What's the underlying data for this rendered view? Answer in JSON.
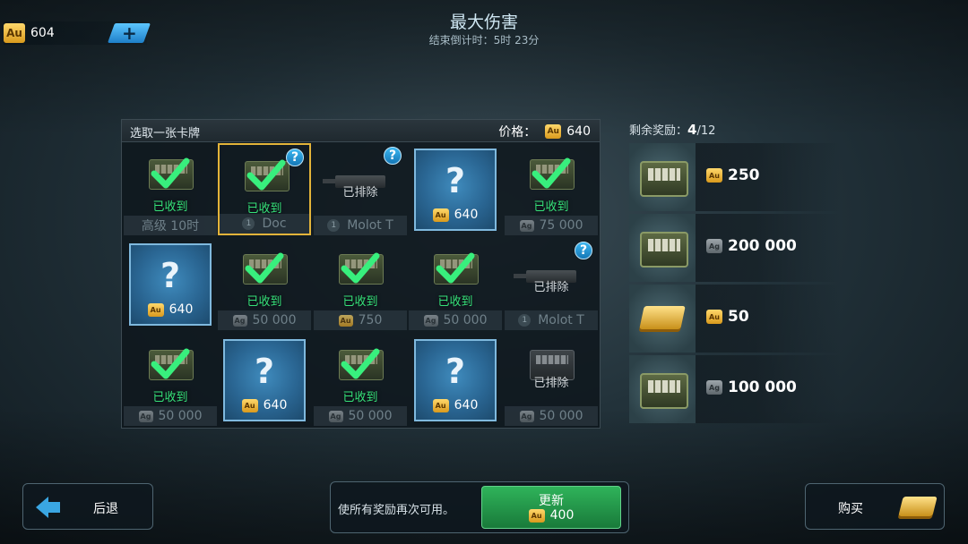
{
  "currency": {
    "badge": "Au",
    "amount": "604",
    "add_label": "+"
  },
  "header": {
    "title": "最大伤害",
    "subtitle": "结束倒计时：5时 23分"
  },
  "board": {
    "label": "选取一张卡牌",
    "price_label": "价格：",
    "price_badge": "Au",
    "price": "640",
    "cells": [
      {
        "state": "got",
        "got_label": "已收到",
        "footer": "高级 10时",
        "footer_icon": "none"
      },
      {
        "state": "got",
        "got_label": "已收到",
        "footer": "Doc",
        "footer_icon": "num",
        "footer_num": "1",
        "selected": true,
        "help": "?"
      },
      {
        "state": "excluded",
        "excluded_label": "已排除",
        "footer": "Molot T",
        "footer_icon": "num",
        "footer_num": "1",
        "help": "?"
      },
      {
        "state": "card",
        "q": "?",
        "badge": "Au",
        "cost": "640"
      },
      {
        "state": "got",
        "got_label": "已收到",
        "footer": "75 000",
        "footer_icon": "ag",
        "footer_badge": "Ag"
      },
      {
        "state": "card",
        "q": "?",
        "badge": "Au",
        "cost": "640"
      },
      {
        "state": "got",
        "got_label": "已收到",
        "footer": "50 000",
        "footer_icon": "ag",
        "footer_badge": "Ag"
      },
      {
        "state": "got",
        "got_label": "已收到",
        "footer": "750",
        "footer_icon": "au",
        "footer_badge": "Au"
      },
      {
        "state": "got",
        "got_label": "已收到",
        "footer": "50 000",
        "footer_icon": "ag",
        "footer_badge": "Ag"
      },
      {
        "state": "excluded",
        "excluded_label": "已排除",
        "footer": "Molot T",
        "footer_icon": "num",
        "footer_num": "1",
        "help": "?"
      },
      {
        "state": "got",
        "got_label": "已收到",
        "footer": "50 000",
        "footer_icon": "ag",
        "footer_badge": "Ag"
      },
      {
        "state": "card",
        "q": "?",
        "badge": "Au",
        "cost": "640"
      },
      {
        "state": "got",
        "got_label": "已收到",
        "footer": "50 000",
        "footer_icon": "ag",
        "footer_badge": "Ag"
      },
      {
        "state": "card",
        "q": "?",
        "badge": "Au",
        "cost": "640"
      },
      {
        "state": "excluded_crate",
        "excluded_label": "已排除",
        "footer": "50 000",
        "footer_icon": "ag",
        "footer_badge": "Ag"
      }
    ]
  },
  "rewards": {
    "label": "剩余奖励：",
    "remaining": "4",
    "total": "/12",
    "items": [
      {
        "thumb": "gold-crate",
        "badge": "Au",
        "value": "250"
      },
      {
        "thumb": "silver-crate",
        "badge": "Ag",
        "value": "200 000"
      },
      {
        "thumb": "gold-bars",
        "badge": "Au",
        "value": "50"
      },
      {
        "thumb": "silver-crate",
        "badge": "Ag",
        "value": "100 000"
      }
    ]
  },
  "footer": {
    "back_label": "后退",
    "refresh_text": "使所有奖励再次可用。",
    "refresh_label": "更新",
    "refresh_badge": "Au",
    "refresh_cost": "400",
    "buy_label": "购买"
  },
  "colors": {
    "accent_blue": "#3aa6e2",
    "got_green": "#36e27a",
    "gold": "#e3b43a",
    "button_green": "#2fb35a"
  }
}
